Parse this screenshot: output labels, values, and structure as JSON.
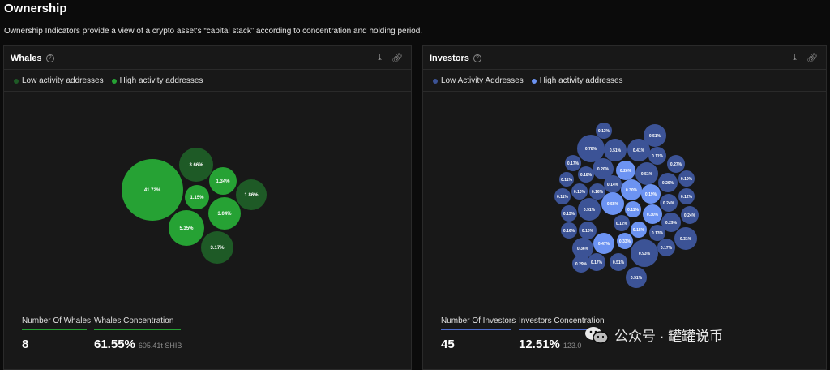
{
  "page": {
    "title": "Ownership",
    "subtitle": "Ownership Indicators provide a view of a crypto asset's “capital stack” according to concentration and holding period."
  },
  "whales": {
    "title": "Whales",
    "legend": [
      {
        "label": "Low activity addresses",
        "color": "#1e5a26"
      },
      {
        "label": "High activity addresses",
        "color": "#26a234"
      }
    ],
    "bubbles": [
      {
        "label": "41.72%",
        "value": 41.72,
        "active": "high"
      },
      {
        "label": "3.66%",
        "value": 3.66,
        "active": "low"
      },
      {
        "label": "1.34%",
        "value": 1.34,
        "active": "high"
      },
      {
        "label": "1.15%",
        "value": 1.15,
        "active": "high"
      },
      {
        "label": "1.86%",
        "value": 1.86,
        "active": "low"
      },
      {
        "label": "3.04%",
        "value": 3.04,
        "active": "high"
      },
      {
        "label": "5.35%",
        "value": 5.35,
        "active": "high"
      },
      {
        "label": "3.17%",
        "value": 3.17,
        "active": "low"
      }
    ],
    "stats": {
      "count_label": "Number Of Whales",
      "count_value": "8",
      "conc_label": "Whales Concentration",
      "conc_value": "61.55%",
      "conc_sub": "605.41t SHIB"
    }
  },
  "investors": {
    "title": "Investors",
    "legend": [
      {
        "label": "Low Activity Addresses",
        "color": "#3c5396"
      },
      {
        "label": "High activity addresses",
        "color": "#6c93f2"
      }
    ],
    "bubbles": [
      {
        "label": "0.13%",
        "value": 0.13,
        "active": "low"
      },
      {
        "label": "0.51%",
        "value": 0.51,
        "active": "low"
      },
      {
        "label": "0.78%",
        "value": 0.78,
        "active": "low"
      },
      {
        "label": "0.51%",
        "value": 0.51,
        "active": "low"
      },
      {
        "label": "0.41%",
        "value": 0.41,
        "active": "low"
      },
      {
        "label": "0.11%",
        "value": 0.11,
        "active": "low"
      },
      {
        "label": "0.17%",
        "value": 0.17,
        "active": "low"
      },
      {
        "label": "0.27%",
        "value": 0.27,
        "active": "low"
      },
      {
        "label": "0.20%",
        "value": 0.2,
        "active": "low"
      },
      {
        "label": "0.26%",
        "value": 0.26,
        "active": "high"
      },
      {
        "label": "0.51%",
        "value": 0.51,
        "active": "low"
      },
      {
        "label": "0.18%",
        "value": 0.18,
        "active": "low"
      },
      {
        "label": "0.11%",
        "value": 0.11,
        "active": "low"
      },
      {
        "label": "0.14%",
        "value": 0.14,
        "active": "low"
      },
      {
        "label": "0.30%",
        "value": 0.3,
        "active": "high"
      },
      {
        "label": "0.26%",
        "value": 0.26,
        "active": "low"
      },
      {
        "label": "0.10%",
        "value": 0.1,
        "active": "low"
      },
      {
        "label": "0.10%",
        "value": 0.1,
        "active": "low"
      },
      {
        "label": "0.16%",
        "value": 0.16,
        "active": "low"
      },
      {
        "label": "0.19%",
        "value": 0.19,
        "active": "high"
      },
      {
        "label": "0.24%",
        "value": 0.24,
        "active": "low"
      },
      {
        "label": "0.12%",
        "value": 0.12,
        "active": "low"
      },
      {
        "label": "0.11%",
        "value": 0.11,
        "active": "low"
      },
      {
        "label": "0.55%",
        "value": 0.55,
        "active": "high"
      },
      {
        "label": "0.11%",
        "value": 0.11,
        "active": "high"
      },
      {
        "label": "0.13%",
        "value": 0.13,
        "active": "low"
      },
      {
        "label": "0.51%",
        "value": 0.51,
        "active": "low"
      },
      {
        "label": "0.30%",
        "value": 0.3,
        "active": "high"
      },
      {
        "label": "0.29%",
        "value": 0.29,
        "active": "low"
      },
      {
        "label": "0.24%",
        "value": 0.24,
        "active": "low"
      },
      {
        "label": "0.15%",
        "value": 0.15,
        "active": "high"
      },
      {
        "label": "0.12%",
        "value": 0.12,
        "active": "low"
      },
      {
        "label": "0.16%",
        "value": 0.16,
        "active": "low"
      },
      {
        "label": "0.10%",
        "value": 0.1,
        "active": "low"
      },
      {
        "label": "0.13%",
        "value": 0.13,
        "active": "low"
      },
      {
        "label": "0.33%",
        "value": 0.33,
        "active": "high"
      },
      {
        "label": "0.31%",
        "value": 0.31,
        "active": "low"
      },
      {
        "label": "0.36%",
        "value": 0.36,
        "active": "low"
      },
      {
        "label": "0.47%",
        "value": 0.47,
        "active": "high"
      },
      {
        "label": "0.93%",
        "value": 0.93,
        "active": "low"
      },
      {
        "label": "0.17%",
        "value": 0.17,
        "active": "low"
      },
      {
        "label": "0.17%",
        "value": 0.17,
        "active": "low"
      },
      {
        "label": "0.51%",
        "value": 0.51,
        "active": "low"
      },
      {
        "label": "0.51%",
        "value": 0.51,
        "active": "low"
      },
      {
        "label": "0.29%",
        "value": 0.29,
        "active": "low"
      }
    ],
    "stats": {
      "count_label": "Number Of Investors",
      "count_value": "45",
      "conc_label": "Investors Concentration",
      "conc_value": "12.51%",
      "conc_sub": "123.0"
    }
  },
  "watermark": {
    "text": "公众号 · 罐罐说币"
  }
}
